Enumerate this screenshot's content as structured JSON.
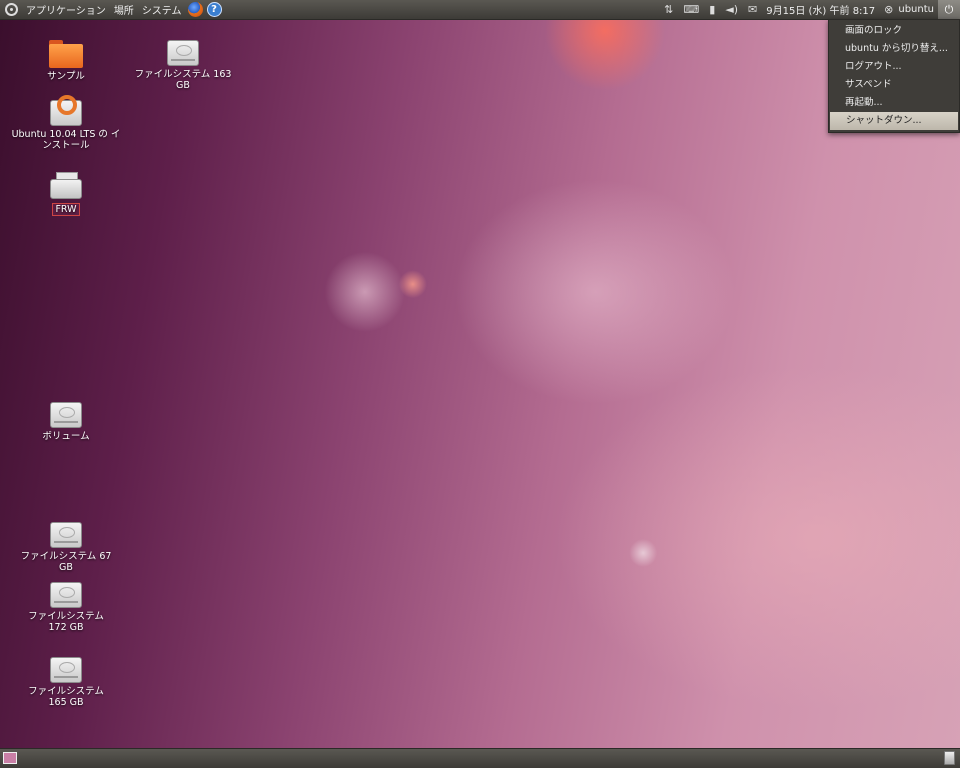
{
  "top_panel": {
    "menus": [
      "アプリケーション",
      "場所",
      "システム"
    ],
    "clock": "9月15日 (水) 午前 8:17",
    "user": "ubuntu"
  },
  "user_menu": {
    "items": [
      "画面のロック",
      "ubuntu から切り替え...",
      "ログアウト...",
      "サスペンド",
      "再起動...",
      "シャットダウン..."
    ],
    "highlighted": "シャットダウン..."
  },
  "desktop_icons": {
    "sample": "サンプル",
    "fs163": "ファイルシステム 163 GB",
    "install": "Ubuntu 10.04 LTS の インストール",
    "cd": "FRW",
    "volume": "ボリューム",
    "fs67": "ファイルシステム 67 GB",
    "fs172": "ファイルシステム 172 GB",
    "fs165": "ファイルシステム 165 GB"
  },
  "icons": {
    "ubuntu": "ubuntu-logo-icon",
    "firefox": "firefox-icon",
    "help": "help-icon",
    "network": "network-icon",
    "keyboard": "keyboard-icon",
    "battery": "battery-icon",
    "volume": "volume-icon",
    "mail": "mail-icon",
    "power": "power-icon"
  }
}
